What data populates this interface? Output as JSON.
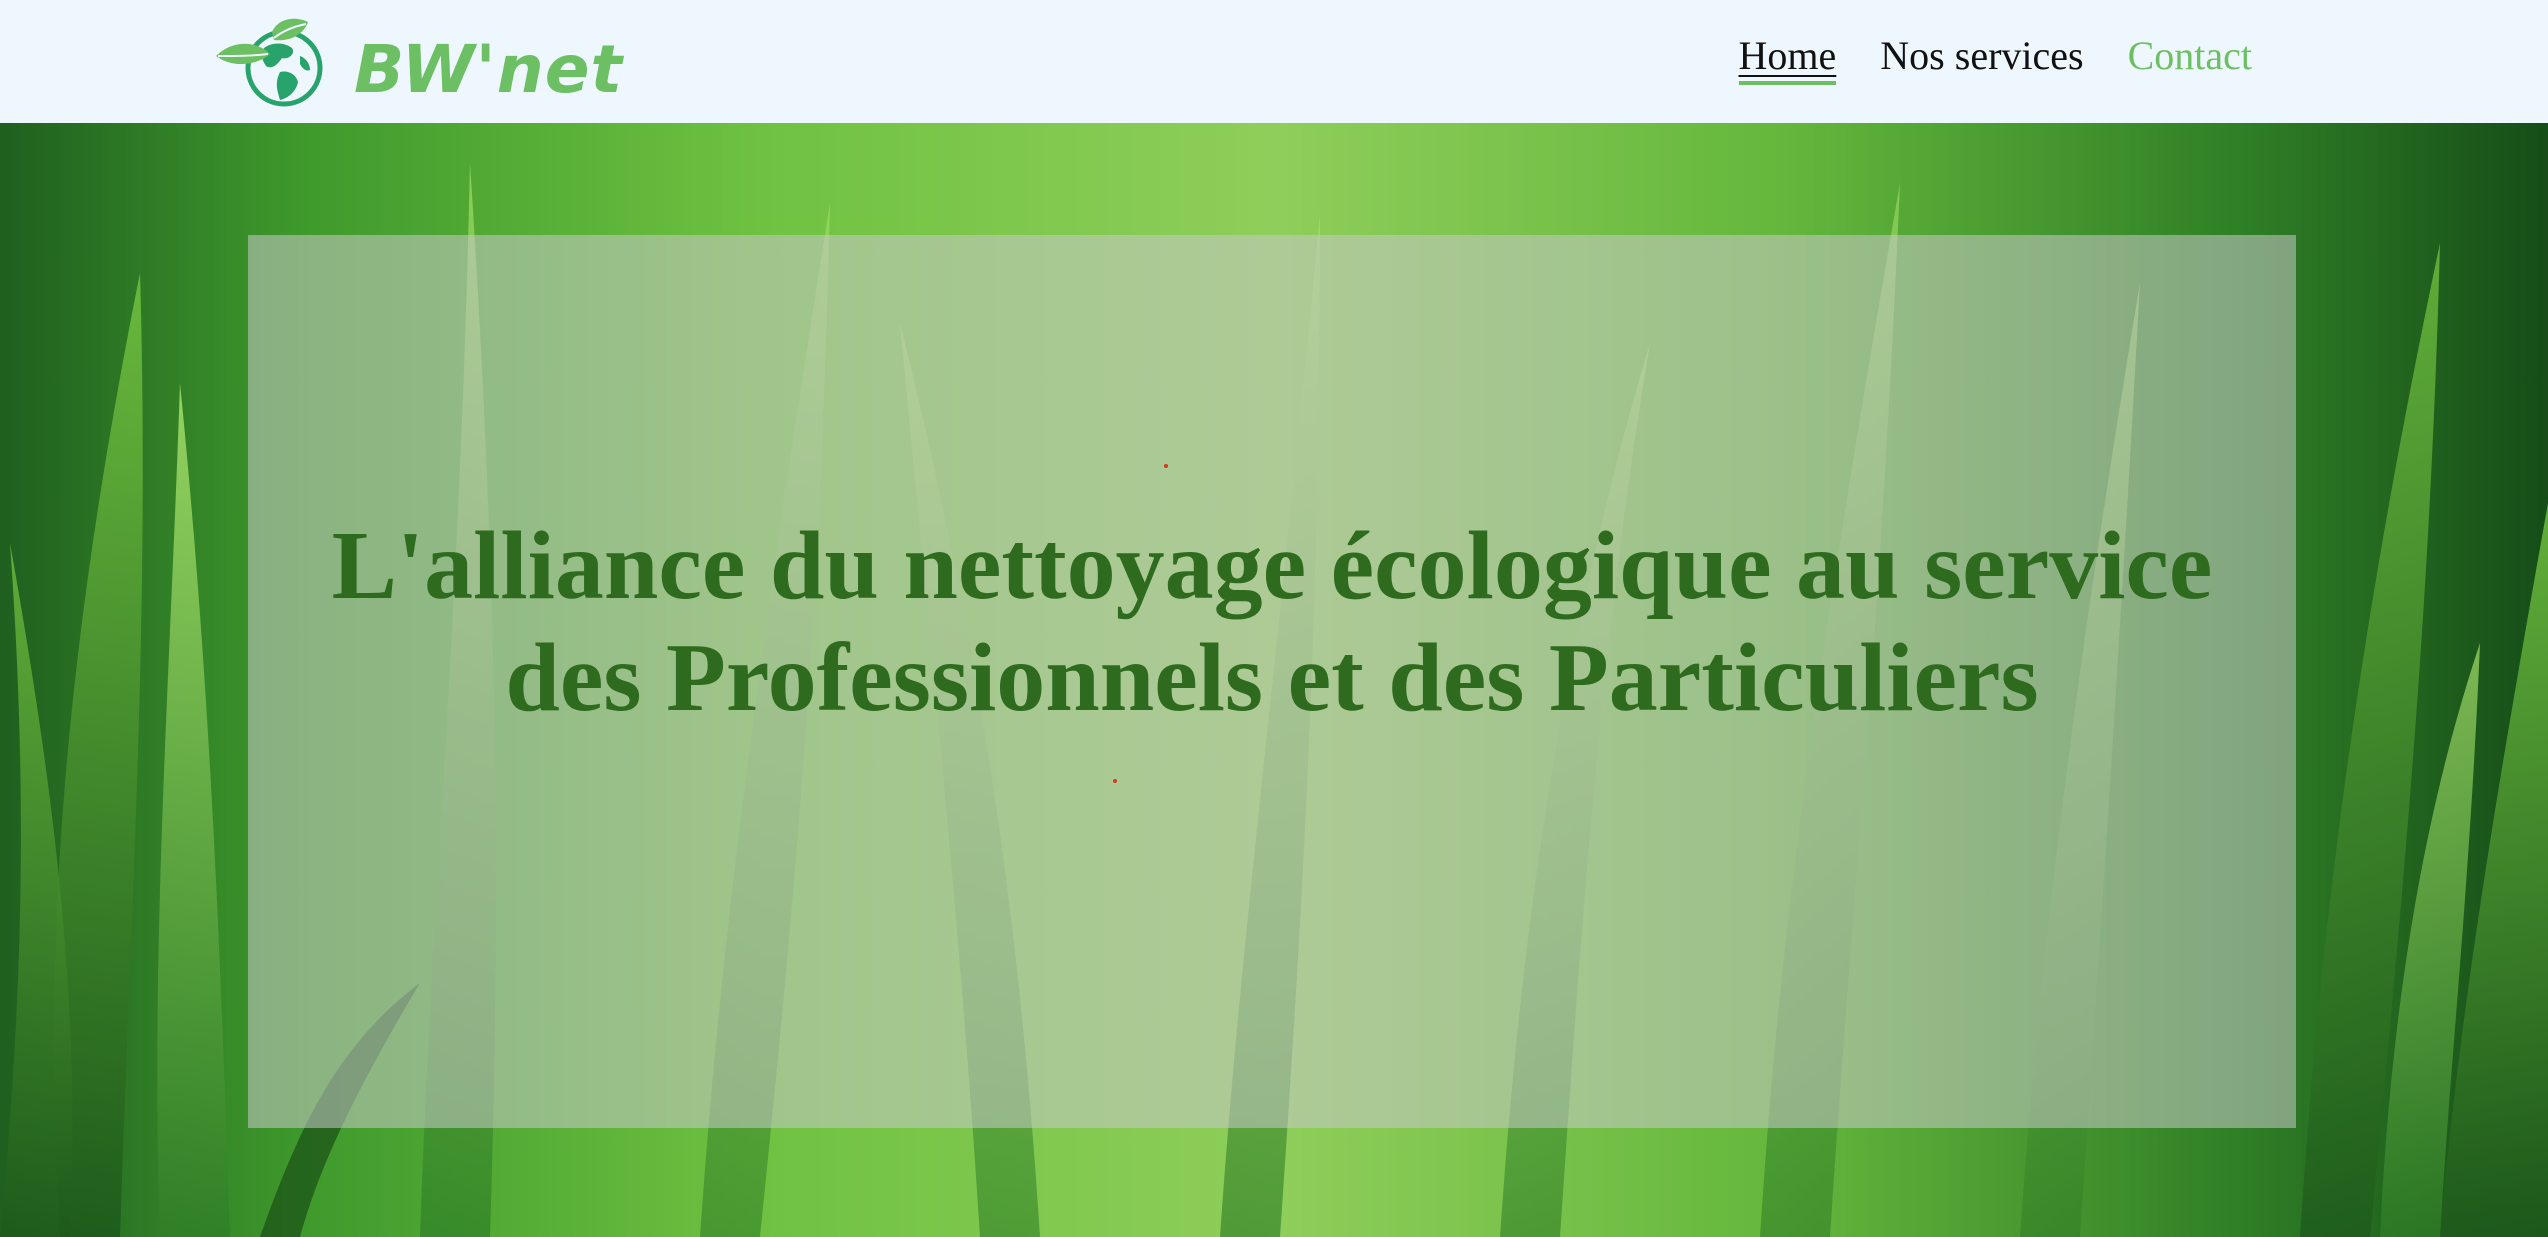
{
  "brand": {
    "name": "BW'net",
    "logo_icon": "globe-leaf-icon",
    "color": "#6cc063"
  },
  "nav": {
    "items": [
      {
        "label": "Home",
        "state": "active"
      },
      {
        "label": "Nos services",
        "state": "default"
      },
      {
        "label": "Contact",
        "state": "accent"
      }
    ]
  },
  "hero": {
    "background": "green-grass-photo",
    "headline": "L'alliance du nettoyage écologique au service des Professionnels et des Particuliers",
    "headline_color": "#2e6b1f",
    "overlay_color": "#c8c8c8"
  },
  "colors": {
    "navbar_bg": "#eef6fe",
    "accent": "#6cc063"
  }
}
